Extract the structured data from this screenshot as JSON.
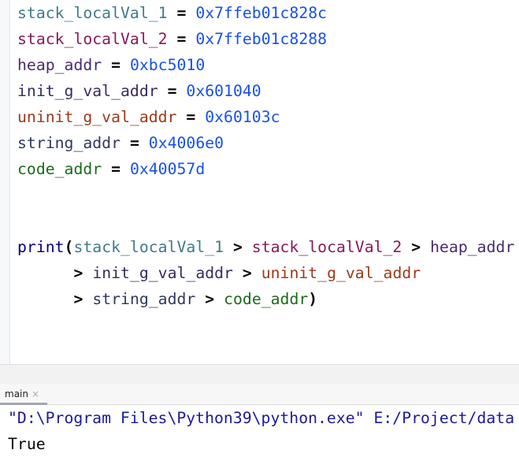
{
  "editor": {
    "assignments": [
      {
        "name": "stack_localVal_1",
        "op": "=",
        "value": "0x7ffeb01c828c",
        "color": "#3f7a8a"
      },
      {
        "name": "stack_localVal_2",
        "op": "=",
        "value": "0x7ffeb01c8288",
        "color": "#871a5a"
      },
      {
        "name": "heap_addr",
        "op": "=",
        "value": "0xbc5010",
        "color": "#4b2a6e"
      },
      {
        "name": "init_g_val_addr",
        "op": "=",
        "value": "0x601040",
        "color": "#3a2a5e"
      },
      {
        "name": "uninit_g_val_addr",
        "op": "=",
        "value": "0x60103c",
        "color": "#9a3a1a"
      },
      {
        "name": "string_addr",
        "op": "=",
        "value": "0x4006e0",
        "color": "#2e3a5e"
      },
      {
        "name": "code_addr",
        "op": "=",
        "value": "0x40057d",
        "color": "#1a6a1a"
      }
    ],
    "print": {
      "func": "print",
      "open": "(",
      "close": ")",
      "gt": ">"
    }
  },
  "run_panel": {
    "tab_label": "main",
    "tab_close": "×",
    "command": "\"D:\\Program Files\\Python39\\python.exe\" E:/Project/data",
    "output": "True"
  }
}
